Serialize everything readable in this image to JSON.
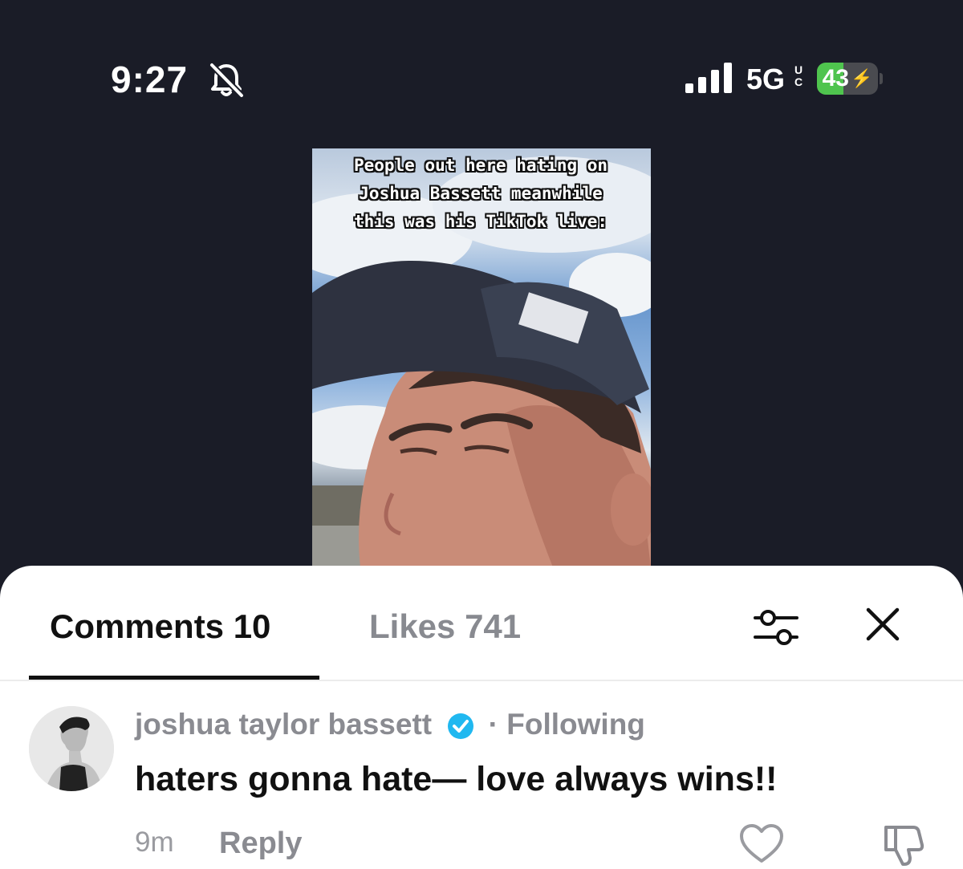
{
  "status_bar": {
    "time": "9:27",
    "network": "5G",
    "network_suffix_top": "U",
    "network_suffix_bottom": "C",
    "battery_level": "43",
    "battery_fraction": 0.43,
    "battery_charging_glyph": "⚡",
    "icons": [
      "bell-slash-icon",
      "signal-bars-icon",
      "battery-icon"
    ]
  },
  "video": {
    "overlay_lines": [
      "People out here hating on",
      "Joshua Bassett meanwhile",
      "this was his TikTok live:"
    ]
  },
  "sheet": {
    "tabs": [
      {
        "label": "Comments 10",
        "active": true
      },
      {
        "label": "Likes 741",
        "active": false
      }
    ],
    "icons": [
      "filter-sliders-icon",
      "close-icon"
    ]
  },
  "comments": [
    {
      "author": "joshua taylor bassett",
      "verified": true,
      "separator": "·",
      "relation": "Following",
      "text": "haters gonna hate— love always wins!!",
      "time_ago": "9m",
      "reply_label": "Reply",
      "icons": [
        "heart-icon",
        "thumbs-down-icon",
        "verified-badge-icon"
      ]
    }
  ],
  "colors": {
    "background": "#1a1c27",
    "verified": "#20b8f0",
    "battery_fill": "#4fc44e",
    "muted_text": "#8a8b91"
  }
}
